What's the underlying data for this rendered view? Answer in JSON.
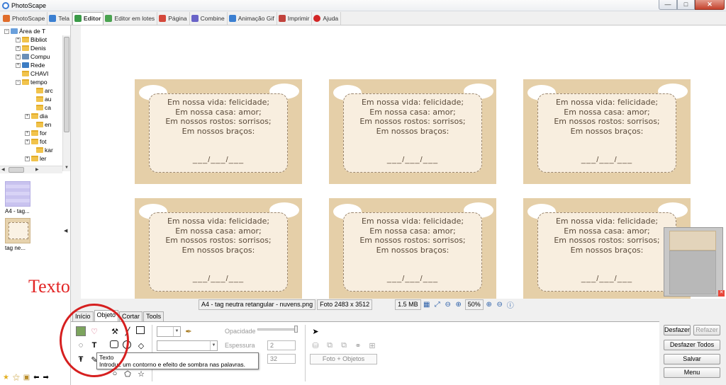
{
  "window": {
    "title": "PhotoScape",
    "min": "—",
    "max": "□",
    "close": "✕"
  },
  "tabs": [
    {
      "label": "PhotoScape",
      "color": "#e06c2a"
    },
    {
      "label": "Tela",
      "color": "#3b7fd1"
    },
    {
      "label": "Editor",
      "color": "#3a9a47",
      "active": true
    },
    {
      "label": "Editor em lotes",
      "color": "#4aa350"
    },
    {
      "label": "Página",
      "color": "#d4483b"
    },
    {
      "label": "Combine",
      "color": "#6a64c8"
    },
    {
      "label": "Animação Gif",
      "color": "#3b7fd1"
    },
    {
      "label": "Imprimir",
      "color": "#c1423c"
    },
    {
      "label": "Ajuda",
      "color": "#d22525"
    }
  ],
  "tree": {
    "root": "Área de T",
    "items": [
      "Bibliot",
      "Denis",
      "Compu",
      "Rede",
      "CHAVI",
      "tempo",
      "arc",
      "au",
      "ca",
      "dia",
      "en",
      "for",
      "fot",
      "kar",
      "ler"
    ]
  },
  "thumbnails": [
    {
      "label": "A4 - tag..."
    },
    {
      "label": "tag ne..."
    }
  ],
  "card": {
    "lines": [
      "Em nossa vida: felicidade;",
      "Em nossa casa: amor;",
      "Em nossos rostos: sorrisos;",
      "Em nossos braços:"
    ],
    "date": "___/___/___"
  },
  "status": {
    "filename": "A4 - tag neutra retangular - nuvens.png",
    "photo": "Foto 2483 x 3512",
    "size": "1.5 MB",
    "zoom": "50%"
  },
  "tool_tabs": [
    {
      "label": "Início"
    },
    {
      "label": "Objeto",
      "active": true
    },
    {
      "label": "Cortar"
    },
    {
      "label": "Tools"
    }
  ],
  "object_panel": {
    "opacity_label": "Opacidade",
    "thickness_label": "Espessura",
    "thickness_value": "2",
    "size_value": "32",
    "photo_objects_button": "Foto + Objetos"
  },
  "tooltip": {
    "title": "Texto",
    "text": "Introduz um contorno e efeito de sombra nas palavras."
  },
  "annotation": {
    "text": "Texto"
  },
  "right_buttons": {
    "undo": "Desfazer",
    "redo": "Refazer",
    "undo_all": "Desfazer Todos",
    "save": "Salvar",
    "menu": "Menu"
  }
}
